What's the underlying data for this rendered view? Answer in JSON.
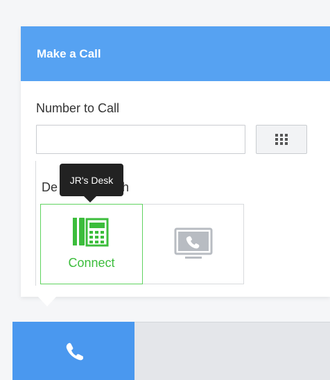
{
  "panel": {
    "title": "Make a Call"
  },
  "number_field": {
    "label": "Number to Call",
    "value": "",
    "placeholder": ""
  },
  "keypad": {
    "icon": "dialpad-icon"
  },
  "device_section": {
    "label": "Device to Call With",
    "label_visible_start": "De",
    "label_visible_end": "l With",
    "devices": [
      {
        "name": "JR's Desk",
        "icon": "desk-phone-icon",
        "action_label": "Connect",
        "selected": true
      },
      {
        "name": "",
        "icon": "softphone-monitor-icon",
        "selected": false
      }
    ]
  },
  "tooltip": {
    "text": "JR's Desk"
  },
  "bottom_nav": {
    "active_tab_icon": "phone-icon"
  },
  "colors": {
    "header_bg": "#56a2f2",
    "active_green": "#3cbd3c",
    "selected_border": "#5fd35f",
    "tab_blue": "#4a98ef"
  }
}
